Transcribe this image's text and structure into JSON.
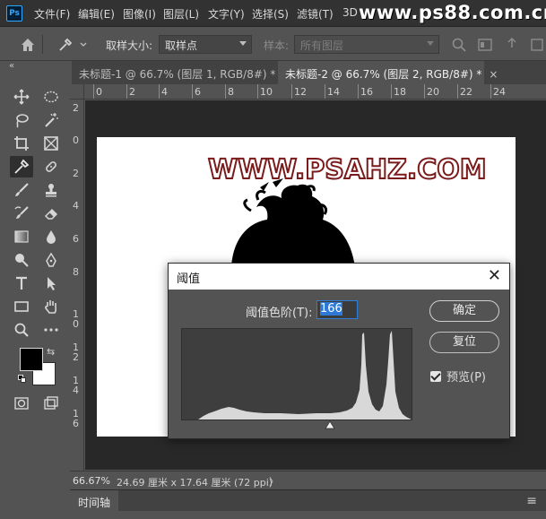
{
  "app": {
    "logo_text": "Ps"
  },
  "menu": {
    "items": [
      "文件(F)",
      "编辑(E)",
      "图像(I)",
      "图层(L)",
      "文字(Y)",
      "选择(S)",
      "滤镜(T)",
      "3D"
    ]
  },
  "watermark": "www.ps88.com.cn",
  "options_bar": {
    "sample_size_label": "取样大小:",
    "sample_size_value": "取样点",
    "sample_label": "样本:",
    "sample_value": "所有图层"
  },
  "tabs": [
    {
      "label": "未标题-1 @ 66.7% (图层 1, RGB/8#) *",
      "close": "×"
    },
    {
      "label": "未标题-2 @ 66.7% (图层 2, RGB/8#) *",
      "close": "×"
    }
  ],
  "ruler": {
    "h_labels": [
      "2",
      "0",
      "2",
      "4",
      "6",
      "8",
      "10",
      "12",
      "14",
      "16",
      "18",
      "20",
      "22",
      "24"
    ],
    "v_labels": [
      "2",
      "0",
      "2",
      "4",
      "6",
      "8",
      "1\n0",
      "1\n2",
      "1\n4",
      "1\n6"
    ]
  },
  "canvas": {
    "text": "WWW.PSAHZ.COM"
  },
  "status": {
    "zoom": "66.67%",
    "doc_info": "24.69 厘米 x 17.64 厘米 (72 ppi)",
    "arrow": "〉"
  },
  "timeline": {
    "label": "时间轴"
  },
  "dialog": {
    "title": "阈值",
    "close": "✕",
    "level_label": "阈值色阶(T):",
    "level_value": "166",
    "ok_label": "确定",
    "reset_label": "复位",
    "preview_label": "预览(P)",
    "preview_checked": true
  },
  "colors": {
    "accent": "#2f79d6",
    "brand": "#31a8ff",
    "text_stroke": "#7a1a1a"
  }
}
